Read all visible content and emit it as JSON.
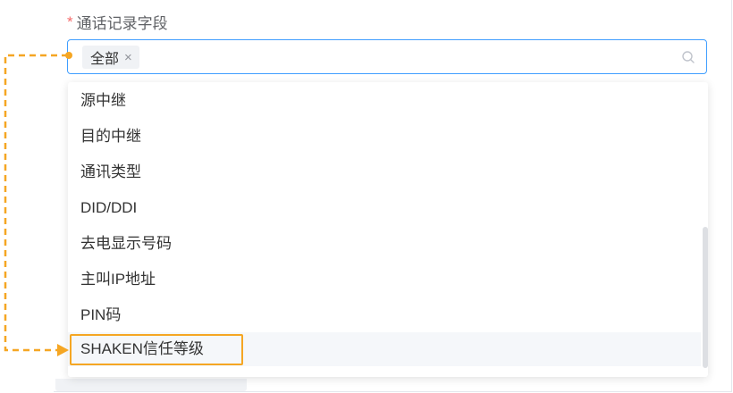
{
  "field": {
    "required_mark": "*",
    "label": "通话记录字段"
  },
  "select": {
    "selected_tag": "全部",
    "tag_close_glyph": "×",
    "search_icon": "search-icon"
  },
  "dropdown": {
    "options": [
      {
        "label": "源中继"
      },
      {
        "label": "目的中继"
      },
      {
        "label": "通讯类型"
      },
      {
        "label": "DID/DDI"
      },
      {
        "label": "去电显示号码"
      },
      {
        "label": "主叫IP地址"
      },
      {
        "label": "PIN码"
      },
      {
        "label": "SHAKEN信任等级"
      }
    ],
    "hovered_option": "SHAKEN信任等级"
  },
  "annotation": {
    "highlighted_option": "SHAKEN信任等级"
  },
  "colors": {
    "accent": "#409eff",
    "required": "#f56c6c",
    "annotation": "#f5a623"
  }
}
